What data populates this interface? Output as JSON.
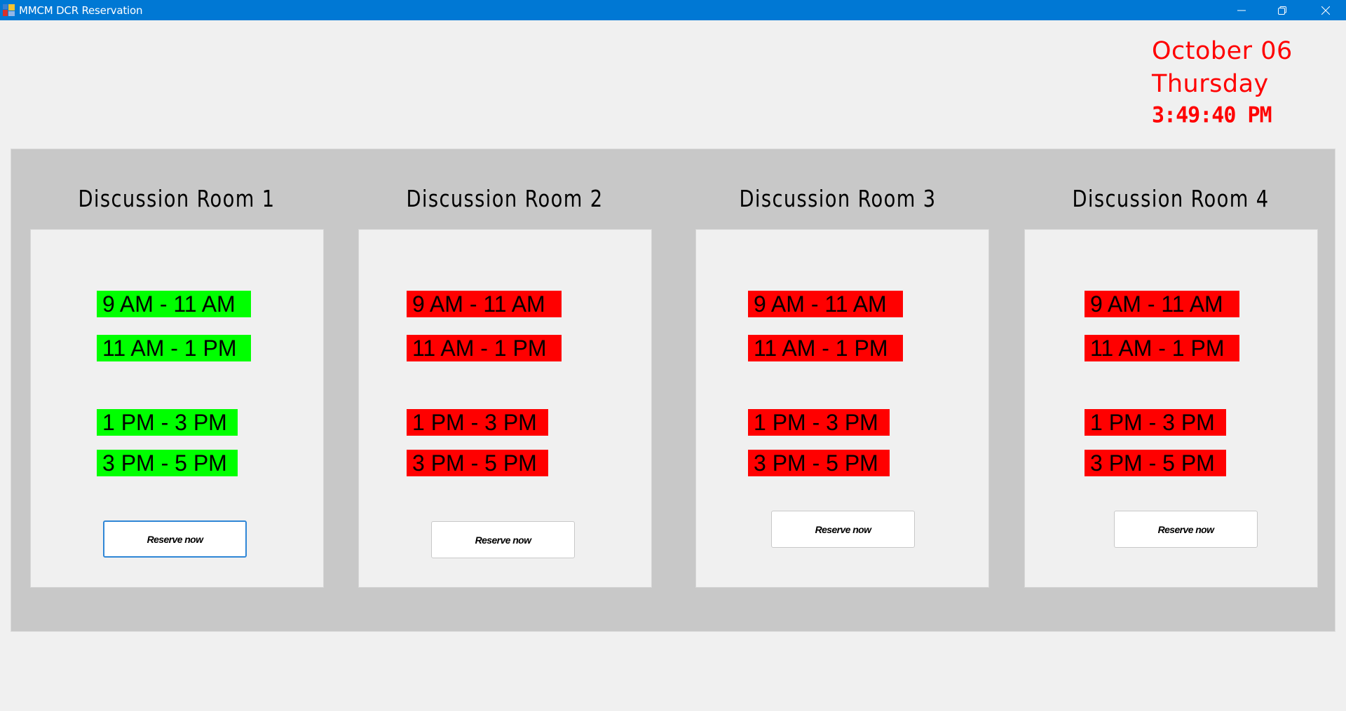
{
  "window": {
    "title": "MMCM DCR Reservation",
    "icon": "app-icon",
    "controls": {
      "minimize": "minimize-icon",
      "restore": "restore-icon",
      "close": "close-icon"
    }
  },
  "clock": {
    "date": "October 06",
    "day": "Thursday",
    "time": "3:49:40 PM",
    "color": "#ff0000"
  },
  "colors": {
    "available": "#00ff00",
    "booked": "#ff0000",
    "panel": "#c8c8c8"
  },
  "rooms": [
    {
      "title": "Discussion Room 1",
      "slots": [
        {
          "label": "9 AM - 11 AM",
          "status": "available"
        },
        {
          "label": "11 AM - 1 PM",
          "status": "available"
        },
        {
          "label": "1 PM - 3 PM",
          "status": "available"
        },
        {
          "label": "3 PM - 5 PM",
          "status": "available"
        }
      ],
      "button": "Reserve now"
    },
    {
      "title": "Discussion Room 2",
      "slots": [
        {
          "label": "9 AM - 11 AM",
          "status": "booked"
        },
        {
          "label": "11 AM - 1 PM",
          "status": "booked"
        },
        {
          "label": "1 PM - 3 PM",
          "status": "booked"
        },
        {
          "label": "3 PM - 5 PM",
          "status": "booked"
        }
      ],
      "button": "Reserve now"
    },
    {
      "title": "Discussion Room 3",
      "slots": [
        {
          "label": "9 AM - 11 AM",
          "status": "booked"
        },
        {
          "label": "11 AM - 1 PM",
          "status": "booked"
        },
        {
          "label": "1 PM - 3 PM",
          "status": "booked"
        },
        {
          "label": "3 PM - 5 PM",
          "status": "booked"
        }
      ],
      "button": "Reserve now"
    },
    {
      "title": "Discussion Room 4",
      "slots": [
        {
          "label": "9 AM - 11 AM",
          "status": "booked"
        },
        {
          "label": "11 AM - 1 PM",
          "status": "booked"
        },
        {
          "label": "1 PM - 3 PM",
          "status": "booked"
        },
        {
          "label": "3 PM - 5 PM",
          "status": "booked"
        }
      ],
      "button": "Reserve now"
    }
  ]
}
